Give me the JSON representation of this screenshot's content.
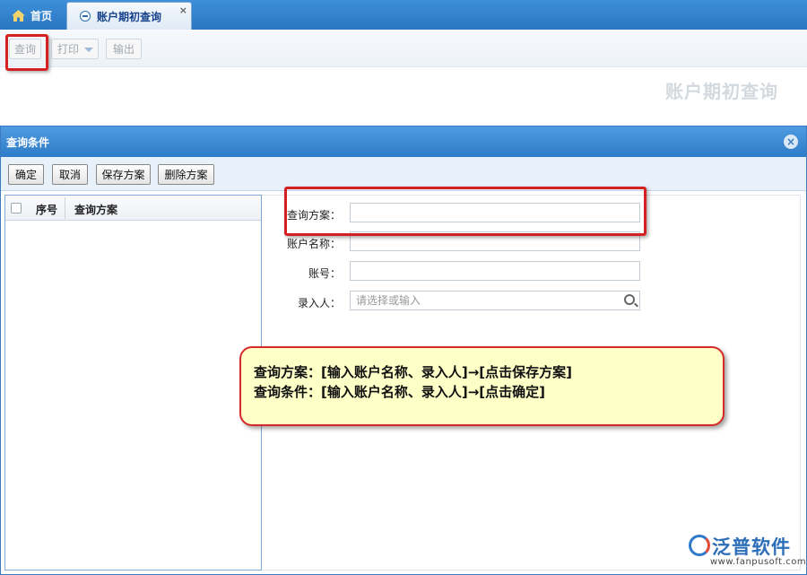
{
  "tabs": [
    {
      "label": "首页",
      "icon": "home-icon"
    },
    {
      "label": "账户期初查询",
      "icon": "page-icon",
      "close": "×"
    }
  ],
  "toolbar": {
    "query": "查询",
    "print": "打印",
    "output": "输出"
  },
  "page_heading": "账户期初查询",
  "dialog": {
    "title": "查询条件",
    "close": "×",
    "buttons": {
      "confirm": "确定",
      "cancel": "取消",
      "save_plan": "保存方案",
      "delete_plan": "删除方案"
    },
    "list": {
      "col_seq": "序号",
      "col_plan": "查询方案",
      "rows": []
    },
    "form": {
      "plan_label": "查询方案：",
      "plan_value": "",
      "account_name_label": "账户名称：",
      "account_name_value": "",
      "account_no_label": "账号：",
      "account_no_value": "",
      "entered_by_label": "录入人：",
      "entered_by_placeholder": "请选择或输入"
    }
  },
  "note": {
    "line1": "查询方案：[输入账户名称、录入人]→[点击保存方案]",
    "line2": "查询条件：[输入账户名称、录入人]→[点击确定]"
  },
  "logo": {
    "text": "泛普软件",
    "url": "www.fanpusoft.com"
  },
  "colors": {
    "tab_bar": "#2f7dc8",
    "highlight": "#d42020",
    "note_bg": "#ffffc8"
  }
}
